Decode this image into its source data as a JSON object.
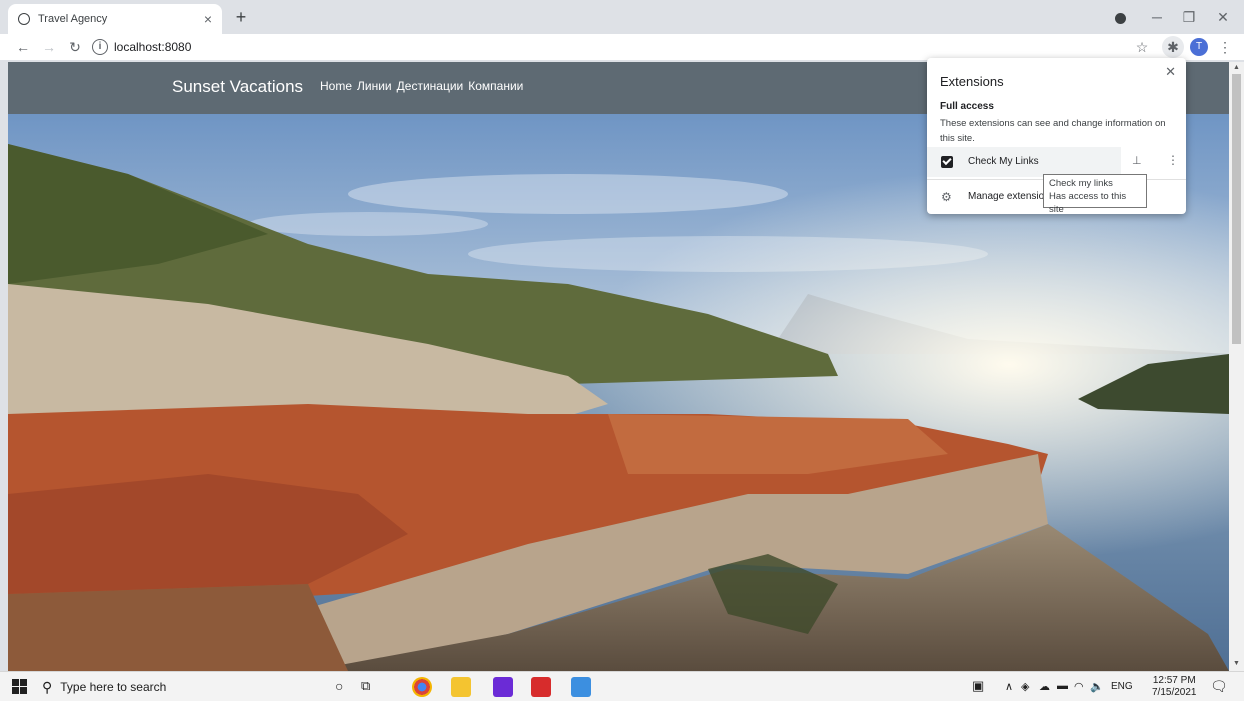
{
  "browser": {
    "tab_title": "Travel Agency",
    "tab_close": "×",
    "new_tab": "+",
    "url": "localhost:8080",
    "avatar_letter": "T"
  },
  "site": {
    "brand": "Sunset Vacations",
    "nav": [
      "Home",
      "Линии",
      "Дестинации",
      "Компании"
    ]
  },
  "extensions_popup": {
    "title": "Extensions",
    "section": "Full access",
    "description": "These extensions can see and change information on this site.",
    "extension_name": "Check My Links",
    "manage_label": "Manage extensions",
    "tooltip_line1": "Check my links",
    "tooltip_line2": "Has access to this site"
  },
  "taskbar": {
    "search_placeholder": "Type here to search",
    "lang": "ENG",
    "time": "12:57 PM",
    "date": "7/15/2021"
  },
  "colors": {
    "navbar": "#5e6a73",
    "sky": "#8fb1d4",
    "sea": "#5b7fa6",
    "roofs": "#b5552f"
  }
}
